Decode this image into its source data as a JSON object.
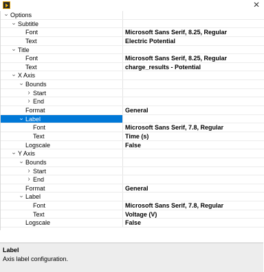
{
  "window": {
    "app_icon": "labview-app-icon",
    "close_glyph": "✕"
  },
  "tree": [
    {
      "label": "Options",
      "value": "",
      "level": 0,
      "expander": "expanded"
    },
    {
      "label": "Subtitle",
      "value": "",
      "level": 1,
      "expander": "expanded"
    },
    {
      "label": "Font",
      "value": "Microsoft Sans Serif, 8.25, Regular",
      "level": 2,
      "expander": "none"
    },
    {
      "label": "Text",
      "value": "Electric Potential",
      "level": 2,
      "expander": "none"
    },
    {
      "label": "Title",
      "value": "",
      "level": 1,
      "expander": "expanded"
    },
    {
      "label": "Font",
      "value": "Microsoft Sans Serif, 8.25, Regular",
      "level": 2,
      "expander": "none"
    },
    {
      "label": "Text",
      "value": "charge_results - Potential",
      "level": 2,
      "expander": "none"
    },
    {
      "label": "X Axis",
      "value": "",
      "level": 1,
      "expander": "expanded"
    },
    {
      "label": "Bounds",
      "value": "",
      "level": 2,
      "expander": "expanded"
    },
    {
      "label": "Start",
      "value": "",
      "level": 3,
      "expander": "collapsed"
    },
    {
      "label": "End",
      "value": "",
      "level": 3,
      "expander": "collapsed"
    },
    {
      "label": "Format",
      "value": "General",
      "level": 2,
      "expander": "none"
    },
    {
      "label": "Label",
      "value": "",
      "level": 2,
      "expander": "expanded",
      "selected": true
    },
    {
      "label": "Font",
      "value": "Microsoft Sans Serif, 7.8, Regular",
      "level": 3,
      "expander": "none"
    },
    {
      "label": "Text",
      "value": "Time (s)",
      "level": 3,
      "expander": "none"
    },
    {
      "label": "Logscale",
      "value": "False",
      "level": 2,
      "expander": "none"
    },
    {
      "label": "Y Axis",
      "value": "",
      "level": 1,
      "expander": "expanded"
    },
    {
      "label": "Bounds",
      "value": "",
      "level": 2,
      "expander": "expanded"
    },
    {
      "label": "Start",
      "value": "",
      "level": 3,
      "expander": "collapsed"
    },
    {
      "label": "End",
      "value": "",
      "level": 3,
      "expander": "collapsed"
    },
    {
      "label": "Format",
      "value": "General",
      "level": 2,
      "expander": "none"
    },
    {
      "label": "Label",
      "value": "",
      "level": 2,
      "expander": "expanded"
    },
    {
      "label": "Font",
      "value": "Microsoft Sans Serif, 7.8, Regular",
      "level": 3,
      "expander": "none"
    },
    {
      "label": "Text",
      "value": "Voltage (V)",
      "level": 3,
      "expander": "none"
    },
    {
      "label": "Logscale",
      "value": "False",
      "level": 2,
      "expander": "none"
    }
  ],
  "description": {
    "title": "Label",
    "text": "Axis label configuration."
  }
}
